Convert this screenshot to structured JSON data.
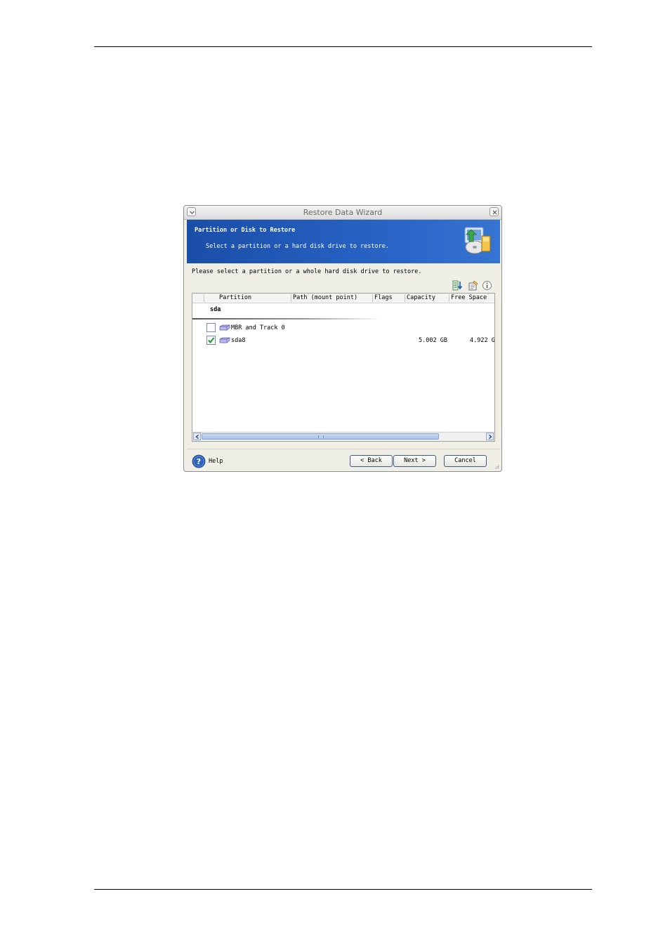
{
  "window": {
    "title": "Restore Data Wizard"
  },
  "banner": {
    "title": "Partition or Disk to Restore",
    "subtitle": "Select a partition or a hard disk drive to restore."
  },
  "instruction": "Please select a partition or a whole hard disk drive to restore.",
  "table": {
    "columns": [
      "Partition",
      "Path (mount point)",
      "Flags",
      "Capacity",
      "Free Space"
    ],
    "group": "sda",
    "rows": [
      {
        "checked": false,
        "label": "MBR and Track 0",
        "capacity": "",
        "free": ""
      },
      {
        "checked": true,
        "label": "sda8",
        "capacity": "5.002 GB",
        "free": "4.922 G"
      }
    ]
  },
  "footer": {
    "help": "Help",
    "back": "< Back",
    "next": "Next >",
    "cancel": "Cancel"
  },
  "colors": {
    "banner": "#2a66c8",
    "window_bg": "#efefe6",
    "scroll_thumb": "#b9cdef"
  },
  "icons": [
    "menu-icon",
    "close-icon",
    "restore-wizard-icon",
    "sort-icon",
    "properties-icon",
    "info-icon",
    "disk-icon",
    "checkmark-icon",
    "help-icon",
    "resize-grip-icon"
  ]
}
